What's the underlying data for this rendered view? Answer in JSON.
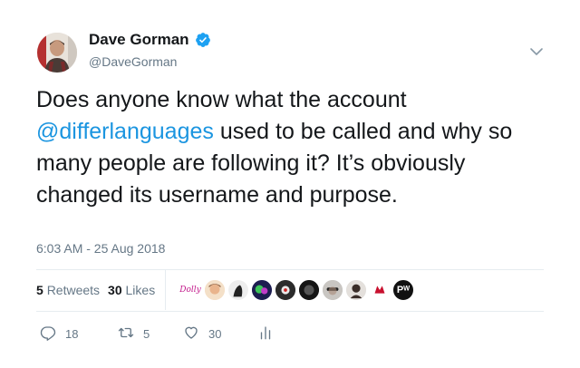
{
  "author": {
    "name": "Dave Gorman",
    "handle": "@DaveGorman",
    "verified": true
  },
  "tweet": {
    "text_before": "Does anyone know what the account ",
    "mention": "@differlanguages",
    "text_after": " used to be called and why so many people are following it? It’s obviously changed its username and purpose.",
    "timestamp": "6:03 AM - 25 Aug 2018"
  },
  "stats": {
    "retweets_count": "5",
    "retweets_label": "Retweets",
    "likes_count": "30",
    "likes_label": "Likes"
  },
  "likers": {
    "first_label": "Dolly",
    "pw_label": "Pᵂ"
  },
  "actions": {
    "reply_count": "18",
    "retweet_count": "5",
    "like_count": "30"
  },
  "colors": {
    "link": "#1b95e0",
    "verified": "#1da1f2",
    "secondary": "#657786"
  }
}
